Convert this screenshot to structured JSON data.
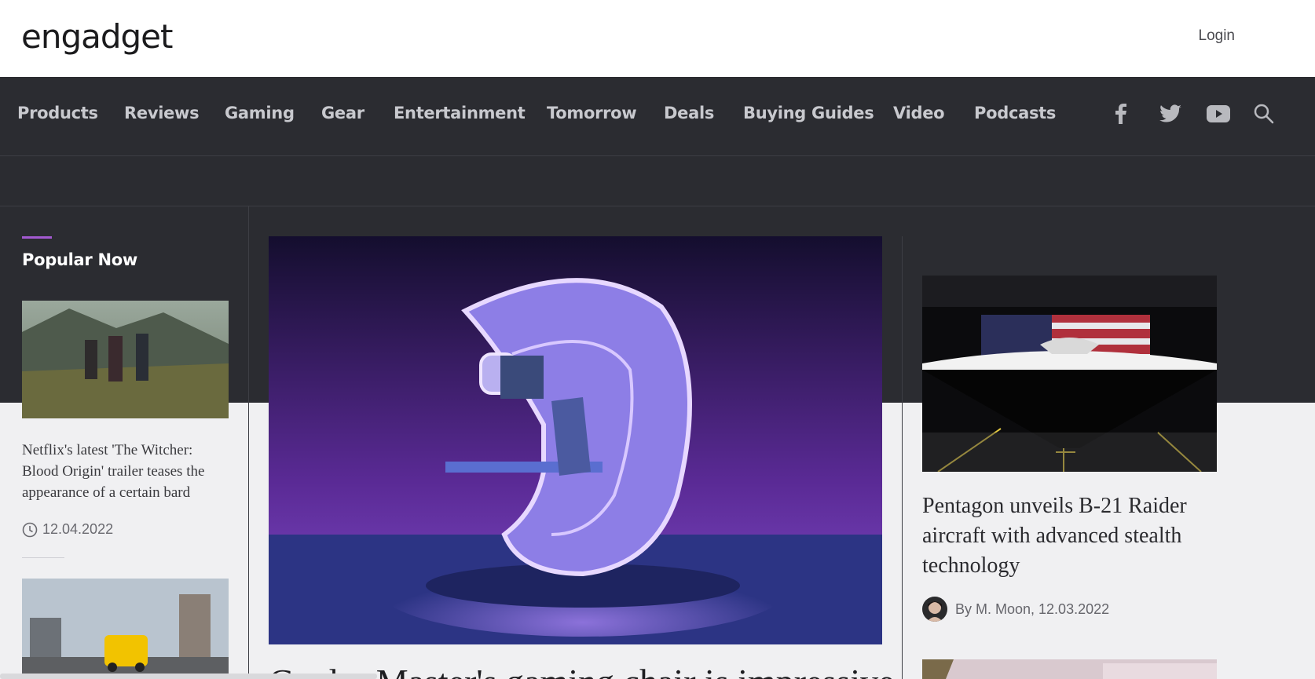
{
  "header": {
    "logo": "engadget",
    "login_label": "Login"
  },
  "nav": {
    "items": [
      "Products",
      "Reviews",
      "Gaming",
      "Gear",
      "Entertainment",
      "Tomorrow",
      "Deals",
      "Buying Guides",
      "Video",
      "Podcasts"
    ],
    "social_icons": [
      "facebook-icon",
      "twitter-icon",
      "youtube-icon",
      "search-icon"
    ]
  },
  "popular": {
    "title": "Popular Now",
    "items": [
      {
        "headline": "Netflix's latest 'The Witcher: Blood Origin' trailer teases the appearance of a certain bard",
        "date": "12.04.2022"
      }
    ]
  },
  "hero": {
    "headline": "Cooler Master's gaming chair is impressive!"
  },
  "sidebar_story": {
    "headline": "Pentagon unveils B-21 Raider aircraft with advanced stealth technology",
    "byline": "By M. Moon, 12.03.2022"
  },
  "colors": {
    "dark_bg": "#2b2c31",
    "accent": "#a35ad1"
  }
}
